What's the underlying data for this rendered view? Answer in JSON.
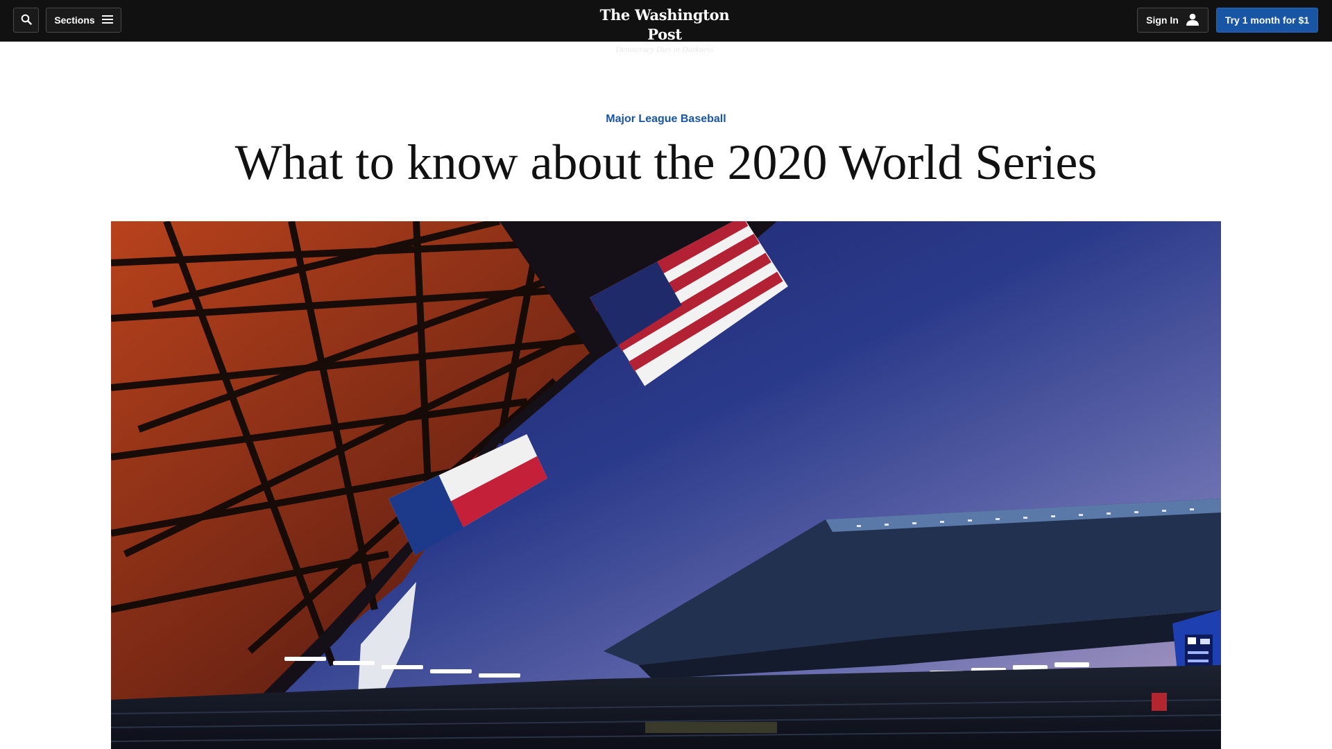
{
  "nav": {
    "search_icon": "search-icon",
    "sections_label": "Sections",
    "sections_icon": "hamburger-menu-icon",
    "signin_label": "Sign In",
    "signin_icon": "user-icon",
    "subscribe_label": "Try 1 month for $1"
  },
  "masthead": {
    "name": "The Washington Post",
    "tagline": "Democracy Dies in Darkness"
  },
  "article": {
    "kicker": "Major League Baseball",
    "headline": "What to know about the 2020 World Series"
  },
  "colors": {
    "topbar": "#111111",
    "accent_blue": "#1955a5",
    "headline": "#111111"
  }
}
